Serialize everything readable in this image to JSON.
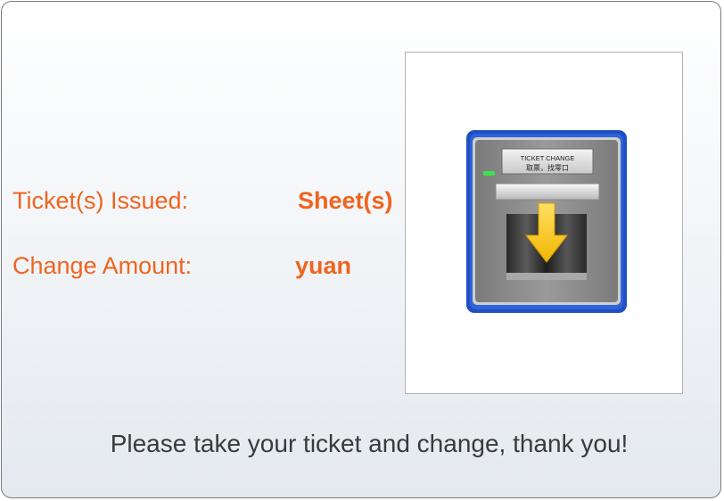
{
  "labels": {
    "tickets_issued": "Ticket(s) Issued:",
    "change_amount": "Change Amount:"
  },
  "units": {
    "tickets": "Sheet(s)",
    "change": "yuan"
  },
  "machine": {
    "sign_line1": "TICKET CHANGE",
    "sign_line2": "取票，找零口"
  },
  "footer": {
    "message": "Please take your ticket and change, thank you!"
  },
  "colors": {
    "label_text": "#f0641e",
    "footer_text": "#3a3a3a",
    "machine_frame": "#1f4fc2",
    "arrow": "#f5c21a"
  }
}
